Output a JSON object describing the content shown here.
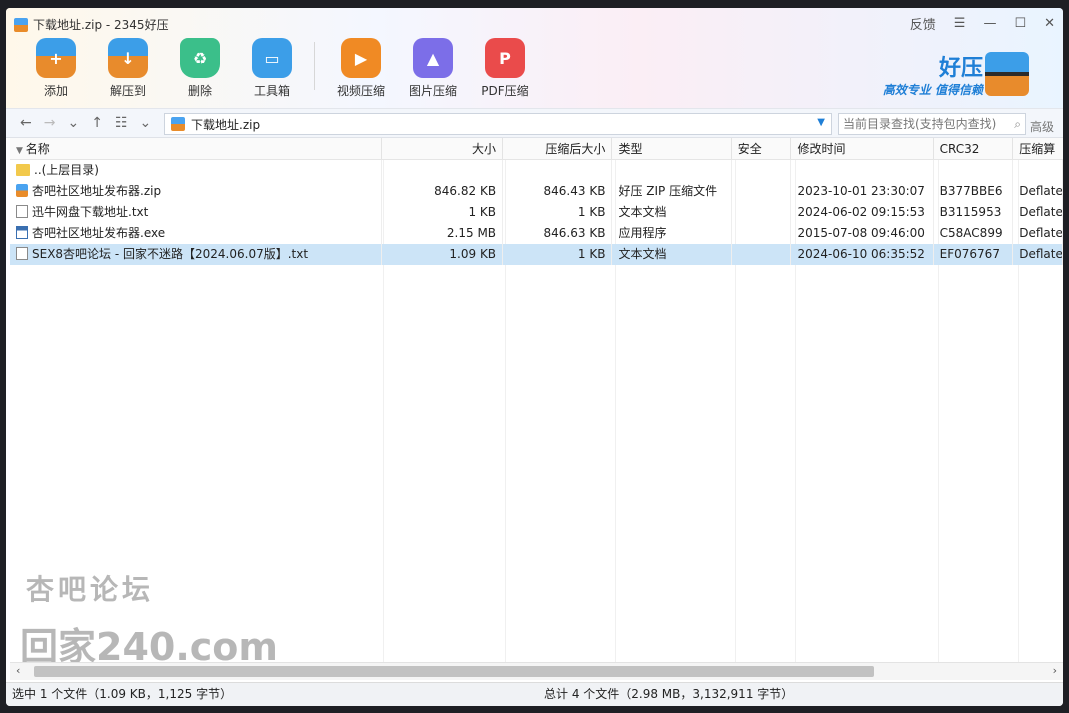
{
  "window": {
    "title": "下载地址.zip - 2345好压",
    "controls": {
      "feedback": "反馈",
      "menu": "☰",
      "minimize": "—",
      "maximize": "☐",
      "close": "✕"
    }
  },
  "toolbar": {
    "add": "添加",
    "extract": "解压到",
    "delete": "删除",
    "toolbox": "工具箱",
    "video": "视频压缩",
    "image": "图片压缩",
    "pdf": "PDF压缩"
  },
  "brand": {
    "name": "好压",
    "slogan": "高效专业  值得信赖"
  },
  "address": {
    "path": "下载地址.zip",
    "search_placeholder": "当前目录查找(支持包内查找)",
    "advanced": "高级"
  },
  "columns": {
    "name": "名称",
    "size": "大小",
    "csize": "压缩后大小",
    "type": "类型",
    "security": "安全",
    "mtime": "修改时间",
    "crc": "CRC32",
    "algo": "压缩算"
  },
  "files": [
    {
      "name": "..(上层目录)",
      "icon": "folder",
      "size": "",
      "csize": "",
      "type": "",
      "security": "",
      "mtime": "",
      "crc": "",
      "algo": ""
    },
    {
      "name": "杏吧社区地址发布器.zip",
      "icon": "zip",
      "size": "846.82 KB",
      "csize": "846.43 KB",
      "type": "好压 ZIP 压缩文件",
      "security": "",
      "mtime": "2023-10-01 23:30:07",
      "crc": "B377BBE6",
      "algo": "Deflate"
    },
    {
      "name": "迅牛网盘下载地址.txt",
      "icon": "txt",
      "size": "1 KB",
      "csize": "1 KB",
      "type": "文本文档",
      "security": "",
      "mtime": "2024-06-02 09:15:53",
      "crc": "B3115953",
      "algo": "Deflate"
    },
    {
      "name": "杏吧社区地址发布器.exe",
      "icon": "exe",
      "size": "2.15 MB",
      "csize": "846.63 KB",
      "type": "应用程序",
      "security": "",
      "mtime": "2015-07-08 09:46:00",
      "crc": "C58AC899",
      "algo": "Deflate"
    },
    {
      "name": "SEX8杏吧论坛 - 回家不迷路【2024.06.07版】.txt",
      "icon": "txt",
      "size": "1.09 KB",
      "csize": "1 KB",
      "type": "文本文档",
      "security": "",
      "mtime": "2024-06-10 06:35:52",
      "crc": "EF076767",
      "algo": "Deflate",
      "selected": true
    }
  ],
  "watermark": {
    "line1": "杏吧论坛",
    "line2": "回家240.com"
  },
  "status": {
    "left": "选中 1 个文件（1.09 KB，1,125 字节）",
    "right": "总计 4 个文件（2.98 MB，3,132,911 字节）"
  }
}
